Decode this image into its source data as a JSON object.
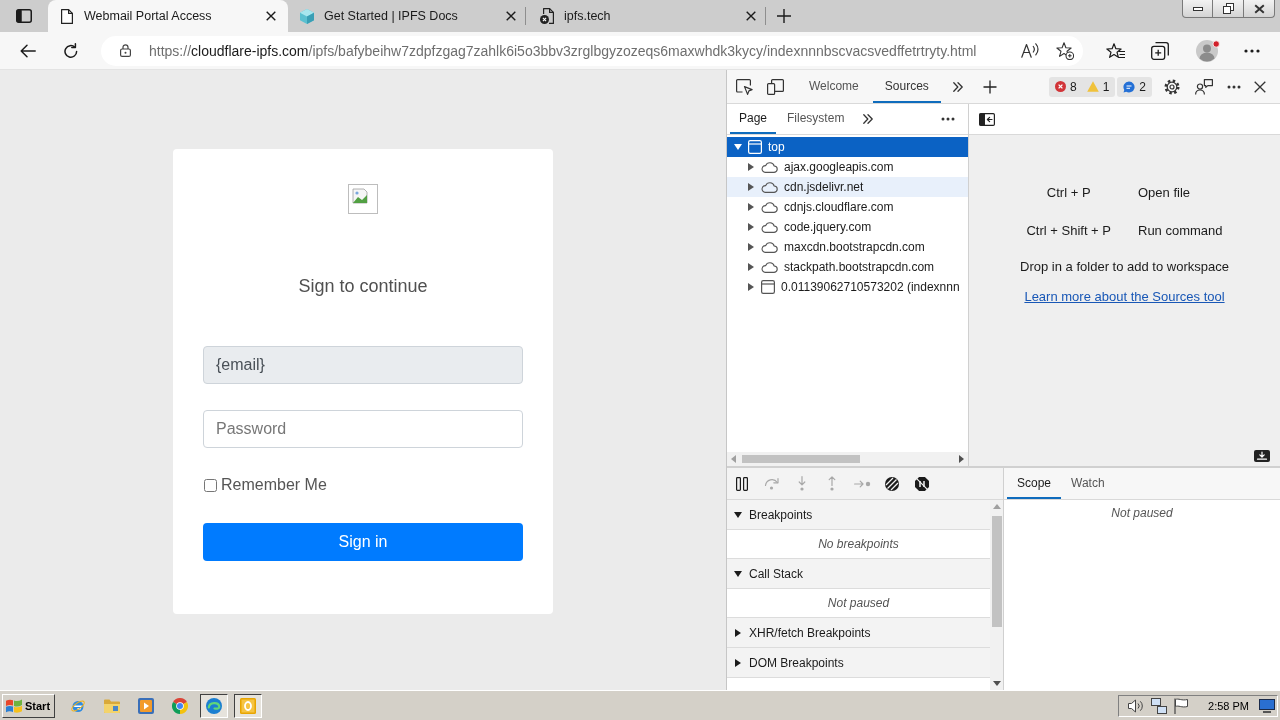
{
  "browser": {
    "tabs": [
      {
        "kind": "document",
        "title": "Webmail Portal Access",
        "selected": true
      },
      {
        "kind": "cube",
        "title": "Get Started | IPFS Docs",
        "selected": false
      },
      {
        "kind": "blocked-document",
        "title": "ipfs.tech",
        "selected": false
      }
    ],
    "url": {
      "scheme": "https://",
      "host": "cloudflare-ipfs.com",
      "path": "/ipfs/bafybeihw7zdpfzgag7zahlk6i5o3bbv3zrglbgyzozeqs6maxwhdk3kycy/indexnnnbscvacsvedffetrtryty.html"
    }
  },
  "page": {
    "heading": "Sign to continue",
    "email": {
      "value": "{email}",
      "disabled": true
    },
    "password": {
      "placeholder": "Password"
    },
    "remember_me": {
      "label": "Remember Me",
      "checked": false
    },
    "sign_in": "Sign in"
  },
  "devtools": {
    "tabs": [
      {
        "label": "Welcome",
        "selected": false
      },
      {
        "label": "Sources",
        "selected": true
      }
    ],
    "issues": {
      "errors": "8",
      "warnings": "1",
      "messages": "2"
    },
    "navigator_tabs": [
      {
        "label": "Page",
        "selected": true
      },
      {
        "label": "Filesystem",
        "selected": false
      }
    ],
    "tree": [
      {
        "kind": "frame",
        "label": "top",
        "expanded": true,
        "selected": true,
        "hovered": false,
        "children": [
          {
            "kind": "domain",
            "label": "ajax.googleapis.com",
            "expanded": false,
            "selected": false,
            "hovered": false
          },
          {
            "kind": "domain",
            "label": "cdn.jsdelivr.net",
            "expanded": false,
            "selected": false,
            "hovered": true
          },
          {
            "kind": "domain",
            "label": "cdnjs.cloudflare.com",
            "expanded": false,
            "selected": false,
            "hovered": false
          },
          {
            "kind": "domain",
            "label": "code.jquery.com",
            "expanded": false,
            "selected": false,
            "hovered": false
          },
          {
            "kind": "domain",
            "label": "maxcdn.bootstrapcdn.com",
            "expanded": false,
            "selected": false,
            "hovered": false
          },
          {
            "kind": "domain",
            "label": "stackpath.bootstrapcdn.com",
            "expanded": false,
            "selected": false,
            "hovered": false
          },
          {
            "kind": "frame",
            "label": "0.01139062710573202 (indexnnn",
            "expanded": false,
            "selected": false,
            "hovered": false
          }
        ]
      }
    ],
    "shortcuts": [
      {
        "keys": "Ctrl + P",
        "action": "Open file"
      },
      {
        "keys": "Ctrl + Shift + P",
        "action": "Run command"
      }
    ],
    "drop_hint": "Drop in a folder to add to workspace",
    "learn_more": "Learn more about the Sources tool",
    "debugger_controls": [
      {
        "kind": "pause",
        "disabled": false
      },
      {
        "kind": "step-over",
        "disabled": true
      },
      {
        "kind": "step-into",
        "disabled": true
      },
      {
        "kind": "step-out",
        "disabled": true
      },
      {
        "kind": "step",
        "disabled": true
      },
      {
        "kind": "deactivate-breakpoints",
        "disabled": false
      },
      {
        "kind": "pause-on-exceptions",
        "disabled": false
      }
    ],
    "sections": [
      {
        "title": "Breakpoints",
        "expanded": true,
        "message": "No breakpoints"
      },
      {
        "title": "Call Stack",
        "expanded": true,
        "message": "Not paused"
      },
      {
        "title": "XHR/fetch Breakpoints",
        "expanded": false
      },
      {
        "title": "DOM Breakpoints",
        "expanded": false
      }
    ],
    "sidebar_tabs": [
      {
        "label": "Scope",
        "selected": true
      },
      {
        "label": "Watch",
        "selected": false
      }
    ],
    "scope_message": "Not paused"
  },
  "taskbar": {
    "start": "Start",
    "apps": [
      {
        "kind": "ringed-circle",
        "active": false
      },
      {
        "kind": "folder",
        "active": false
      },
      {
        "kind": "play-tile",
        "active": false
      },
      {
        "kind": "segmented-circle",
        "active": false
      },
      {
        "kind": "swirl-circle",
        "active": true
      },
      {
        "kind": "ring-tile",
        "active": true
      }
    ],
    "clock": "2:58 PM"
  }
}
